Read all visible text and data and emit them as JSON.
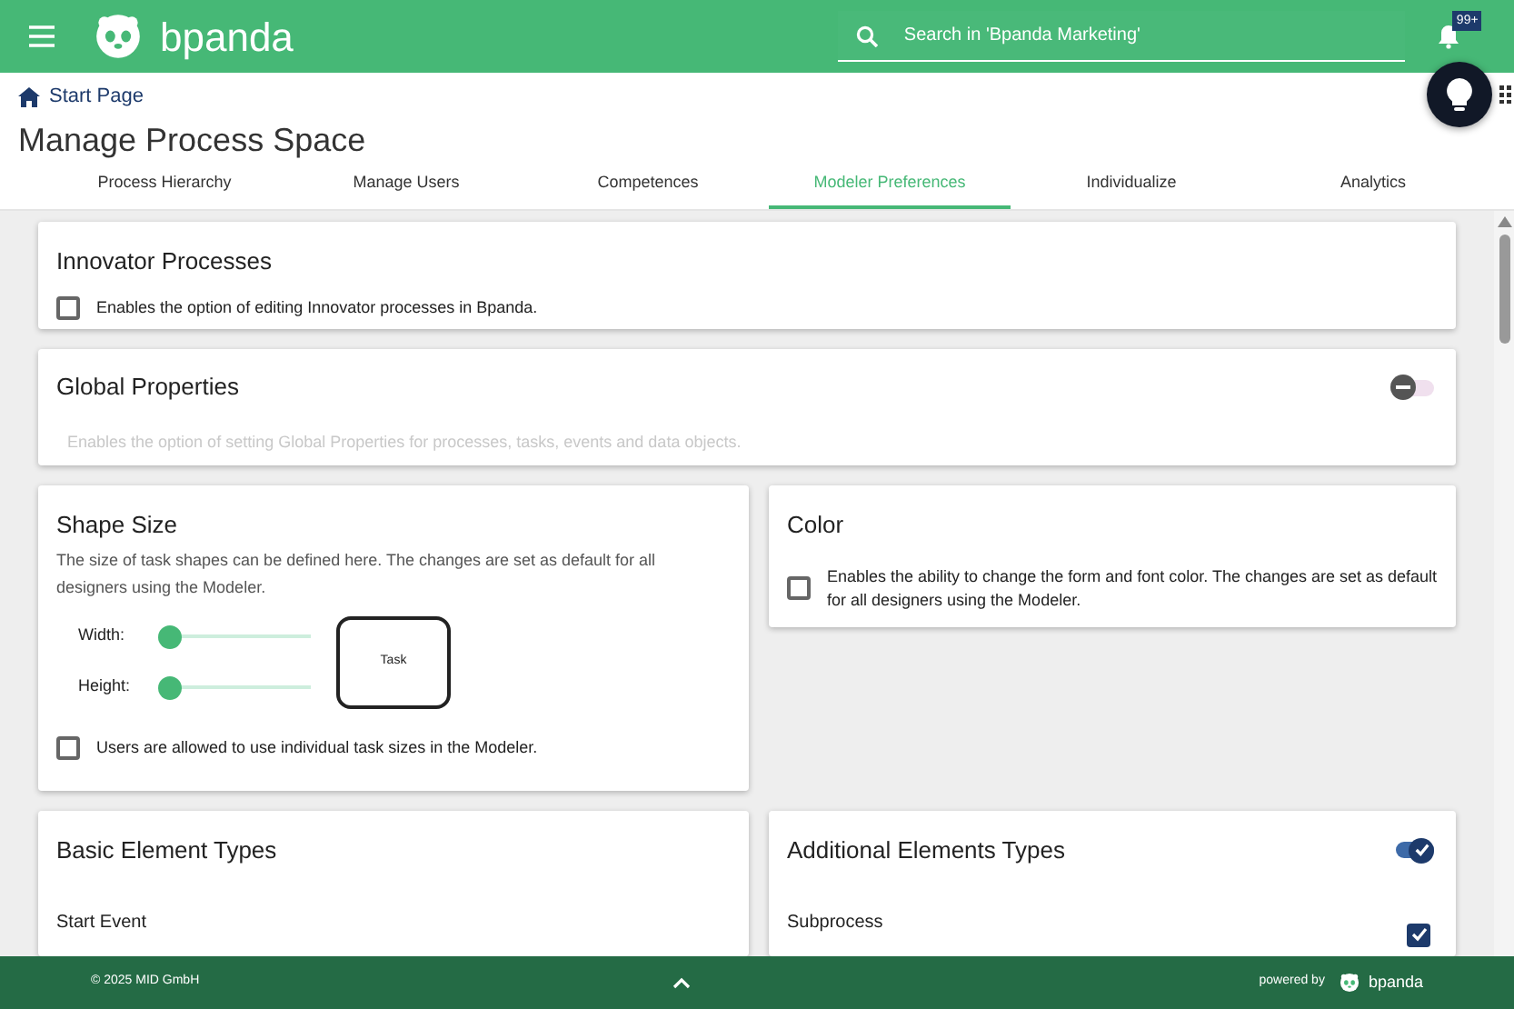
{
  "header": {
    "brand": "bpanda",
    "search": {
      "placeholder": "Search in 'Bpanda Marketing'"
    },
    "notifications": "99+"
  },
  "breadcrumb": "Start Page",
  "title": "Manage Process Space",
  "tabs": [
    {
      "label": "Process Hierarchy",
      "selected": false
    },
    {
      "label": "Manage Users",
      "selected": false
    },
    {
      "label": "Competences",
      "selected": false
    },
    {
      "label": "Modeler Preferences",
      "selected": true
    },
    {
      "label": "Individualize",
      "selected": false
    },
    {
      "label": "Analytics",
      "selected": false
    }
  ],
  "innovator": {
    "title": "Innovator Processes",
    "option": {
      "label": "Enables the option of editing Innovator processes in Bpanda.",
      "checked": false
    }
  },
  "global_properties": {
    "title": "Global Properties",
    "on": false,
    "description": "Enables the option of setting Global Properties for processes, tasks, events and data objects."
  },
  "shape_size": {
    "title": "Shape Size",
    "description": "The size of task shapes can be defined here. The changes are set as default for all designers using the Modeler.",
    "sliders": [
      {
        "label": "Width:",
        "level": 0.0
      },
      {
        "label": "Height:",
        "level": 0.0
      }
    ],
    "preview": "Task",
    "option": {
      "label": "Users are allowed to use individual task sizes in the Modeler.",
      "checked": false
    }
  },
  "color": {
    "title": "Color",
    "option": {
      "label": "Enables the ability to change the form and font color. The changes are set as default for all designers using the Modeler.",
      "checked": false
    }
  },
  "basic_element_types": {
    "title": "Basic Element Types",
    "items": [
      "Start Event"
    ]
  },
  "additional_elements_types": {
    "title": "Additional Elements Types",
    "on": true,
    "items": [
      {
        "label": "Subprocess",
        "checked": true
      }
    ]
  },
  "footer": {
    "copyright": "© 2025 MID GmbH",
    "powered_by": "powered by",
    "brand": "bpanda"
  }
}
